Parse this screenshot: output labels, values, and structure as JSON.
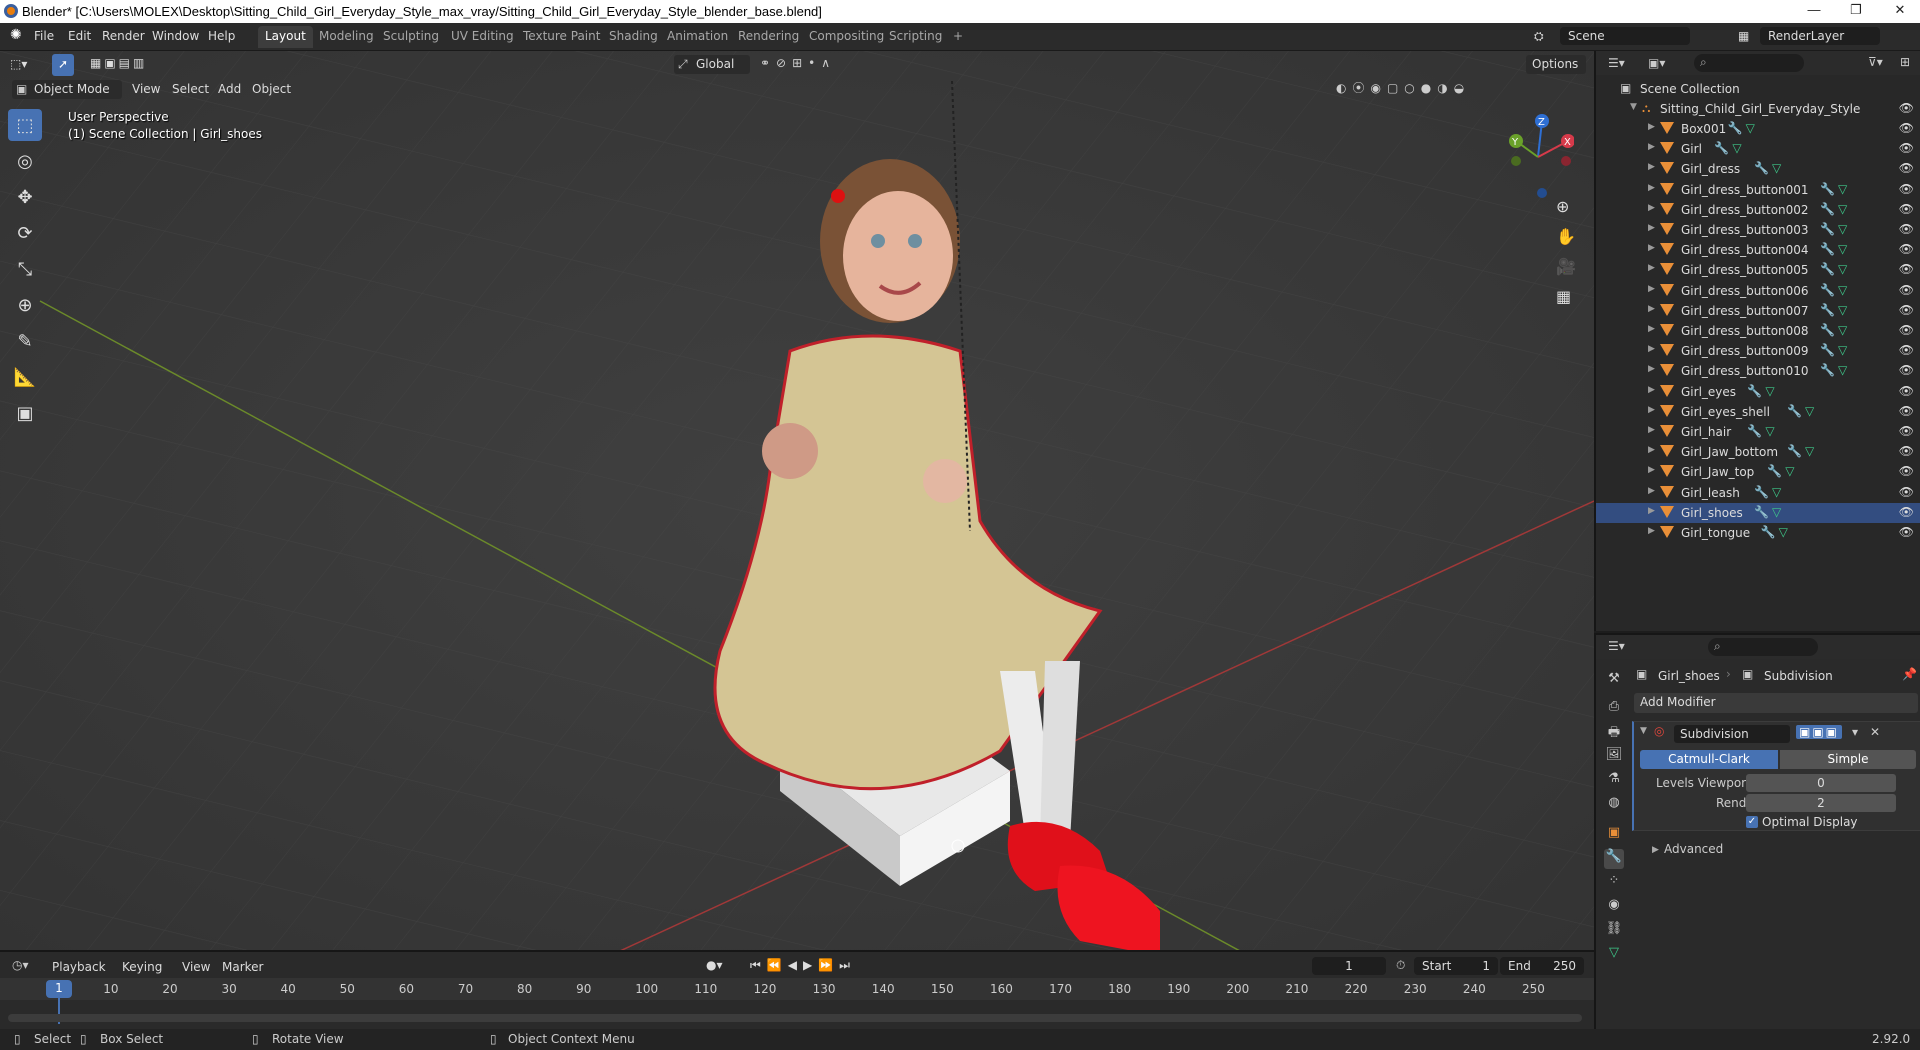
{
  "window": {
    "title": "Blender* [C:\\Users\\MOLEX\\Desktop\\Sitting_Child_Girl_Everyday_Style_max_vray/Sitting_Child_Girl_Everyday_Style_blender_base.blend]",
    "minimize": "—",
    "maximize": "❐",
    "close": "✕"
  },
  "menu": {
    "items": [
      "File",
      "Edit",
      "Render",
      "Window",
      "Help"
    ]
  },
  "workspaces": {
    "tabs": [
      "Layout",
      "Modeling",
      "Sculpting",
      "UV Editing",
      "Texture Paint",
      "Shading",
      "Animation",
      "Rendering",
      "Compositing",
      "Scripting"
    ],
    "add": "+"
  },
  "scene": {
    "name": "Scene",
    "render_layer": "RenderLayer"
  },
  "viewport_header": {
    "mode": "Object Mode",
    "view": "View",
    "select": "Select",
    "add": "Add",
    "object": "Object",
    "orientation": "Global",
    "options": "Options"
  },
  "viewport": {
    "perspective": "User Perspective",
    "collection_info": "(1) Scene Collection | Girl_shoes",
    "gizmo": {
      "z": "Z",
      "y": "Y",
      "x": "X"
    }
  },
  "outliner": {
    "root": "Scene Collection",
    "collection": "Sitting_Child_Girl_Everyday_Style",
    "items": [
      "Box001",
      "Girl",
      "Girl_dress",
      "Girl_dress_button001",
      "Girl_dress_button002",
      "Girl_dress_button003",
      "Girl_dress_button004",
      "Girl_dress_button005",
      "Girl_dress_button006",
      "Girl_dress_button007",
      "Girl_dress_button008",
      "Girl_dress_button009",
      "Girl_dress_button010",
      "Girl_eyes",
      "Girl_eyes_shell",
      "Girl_hair",
      "Girl_Jaw_bottom",
      "Girl_Jaw_top",
      "Girl_leash",
      "Girl_shoes",
      "Girl_tongue"
    ]
  },
  "properties": {
    "object": "Girl_shoes",
    "modifier_context": "Subdivision",
    "add_modifier": "Add Modifier",
    "modifier_name": "Subdivision",
    "catmull": "Catmull-Clark",
    "simple": "Simple",
    "levels_viewport_label": "Levels Viewport",
    "levels_viewport": "0",
    "render_label": "Render",
    "render": "2",
    "optimal_display": "Optimal Display",
    "advanced": "Advanced"
  },
  "timeline": {
    "playback": "Playback",
    "keying": "Keying",
    "view": "View",
    "marker": "Marker",
    "current_frame": "1",
    "start_label": "Start",
    "start": "1",
    "end_label": "End",
    "end": "250",
    "ticks": [
      "1",
      "10",
      "20",
      "30",
      "40",
      "50",
      "60",
      "70",
      "80",
      "90",
      "100",
      "110",
      "120",
      "130",
      "140",
      "150",
      "160",
      "170",
      "180",
      "190",
      "200",
      "210",
      "220",
      "230",
      "240",
      "250"
    ]
  },
  "status": {
    "select": "Select",
    "box_select": "Box Select",
    "rotate_view": "Rotate View",
    "context_menu": "Object Context Menu",
    "version": "2.92.0"
  }
}
